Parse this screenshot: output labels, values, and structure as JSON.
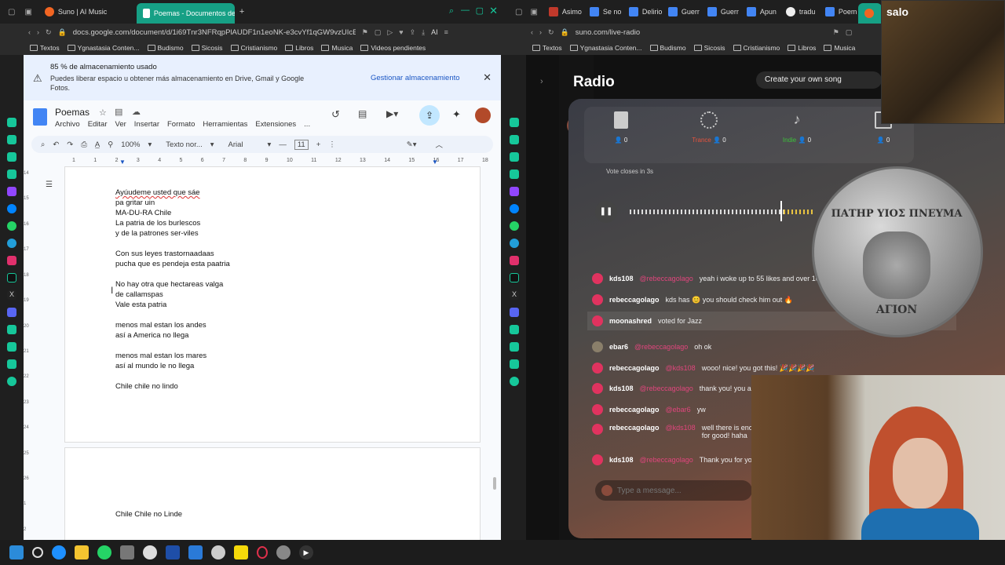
{
  "left": {
    "tabs": [
      {
        "label": "Suno | AI Music",
        "color": "#f26522"
      },
      {
        "label": "Poemas - Documentos de",
        "color": "#4285f4"
      }
    ],
    "url": "docs.google.com/document/d/1i69Tnr3NFRqpPlAUDF1n1eoNK-e3cvYf1qGW9vzUIcE/e",
    "ai_label": "AI",
    "bookmarks": [
      "Textos",
      "Ygnastasia Conten...",
      "Budismo",
      "Sicosis",
      "Cristianismo",
      "Libros",
      "Musica",
      "Videos pendientes"
    ],
    "banner": {
      "title": "85 % de almacenamiento usado",
      "text": "Puedes liberar espacio u obtener más almacenamiento en Drive, Gmail y Google Fotos.",
      "action": "Gestionar almacenamiento"
    },
    "doc": {
      "title": "Poemas",
      "menu": [
        "Archivo",
        "Editar",
        "Ver",
        "Insertar",
        "Formato",
        "Herramientas",
        "Extensiones",
        "..."
      ],
      "zoom": "100%",
      "style": "Texto nor...",
      "font": "Arial",
      "size": "11",
      "ruler": [
        "1",
        "2",
        "1",
        "2",
        "3",
        "4",
        "5",
        "6",
        "7",
        "8",
        "9",
        "10",
        "11",
        "12",
        "13",
        "14",
        "15",
        "16",
        "17",
        "18"
      ],
      "vruler": [
        "14",
        "15",
        "16",
        "17",
        "18",
        "19",
        "20",
        "21",
        "22",
        "23",
        "24",
        "25",
        "26",
        "1",
        "2"
      ],
      "stanzas": [
        [
          "Ayúudeme usted que sáe",
          "pa gritar uin",
          "MA-DU-RA Chile",
          "La patria de los burlescos",
          "y de la patrones ser-viles"
        ],
        [
          "Con sus leyes trastornaadaas",
          "pucha que es pendeja esta paatria"
        ],
        [
          "No hay otra que hectareas valga",
          "de callamspas",
          "Vale esta patria"
        ],
        [
          "menos mal estan los andes",
          "así a America no llega"
        ],
        [
          "menos mal estan los mares",
          "así al mundo le no llega"
        ],
        [
          "Chile chile no lindo"
        ]
      ],
      "page2_line": "Chile Chile no Linde"
    }
  },
  "right": {
    "tabs": [
      "Asimo",
      "Se no",
      "Delirio",
      "Guerr",
      "Guerr",
      "Apun",
      "tradu",
      "Poem",
      ""
    ],
    "url": "suno.com/live-radio",
    "bookmarks": [
      "Textos",
      "Ygnastasia Conten...",
      "Budismo",
      "Sicosis",
      "Cristianismo",
      "Libros",
      "Musica"
    ],
    "page_title": "Radio",
    "create": "Create your own song",
    "genres": [
      {
        "name": "",
        "count": "0",
        "color": "#4a90e2"
      },
      {
        "name": "Trance",
        "count": "0",
        "color": "#e5533d"
      },
      {
        "name": "Indie",
        "count": "0",
        "color": "#3cc13b"
      },
      {
        "name": "",
        "count": "0",
        "color": "#e0467d"
      }
    ],
    "vote": "Vote closes in 3s",
    "chat": [
      {
        "user": "kds108",
        "mention": "@rebeccagolago",
        "text": "yeah i woke up to 55 likes and over 10"
      },
      {
        "user": "rebeccagolago",
        "mention": "",
        "text": "kds has 😊 you should check him out 🔥"
      },
      {
        "user": "moonashred",
        "mention": "",
        "text": "voted for Jazz"
      },
      {
        "user": "ebar6",
        "mention": "@rebeccagolago",
        "text": "oh ok"
      },
      {
        "user": "rebeccagolago",
        "mention": "@kds108",
        "text": "wooo! nice! you got this! 🎉🎉🎉🎉"
      },
      {
        "user": "kds108",
        "mention": "@rebeccagolago",
        "text": "thank you! you a"
      },
      {
        "user": "rebeccagolago",
        "mention": "@ebar6",
        "text": "yw"
      },
      {
        "user": "rebeccagolago",
        "mention": "@kds108",
        "text": "well there is enou\nfor good! haha"
      },
      {
        "user": "kds108",
        "mention": "@rebeccagolago",
        "text": "Thank you for yo"
      }
    ],
    "placeholder": "Type a message...",
    "coin_text": "ΠΑΤΗΡ ΥΙΟΣ ΠΝΕΥΜΑ",
    "coin_bottom": "ΑΓΙΟΝ",
    "overlay_label": "salo"
  }
}
